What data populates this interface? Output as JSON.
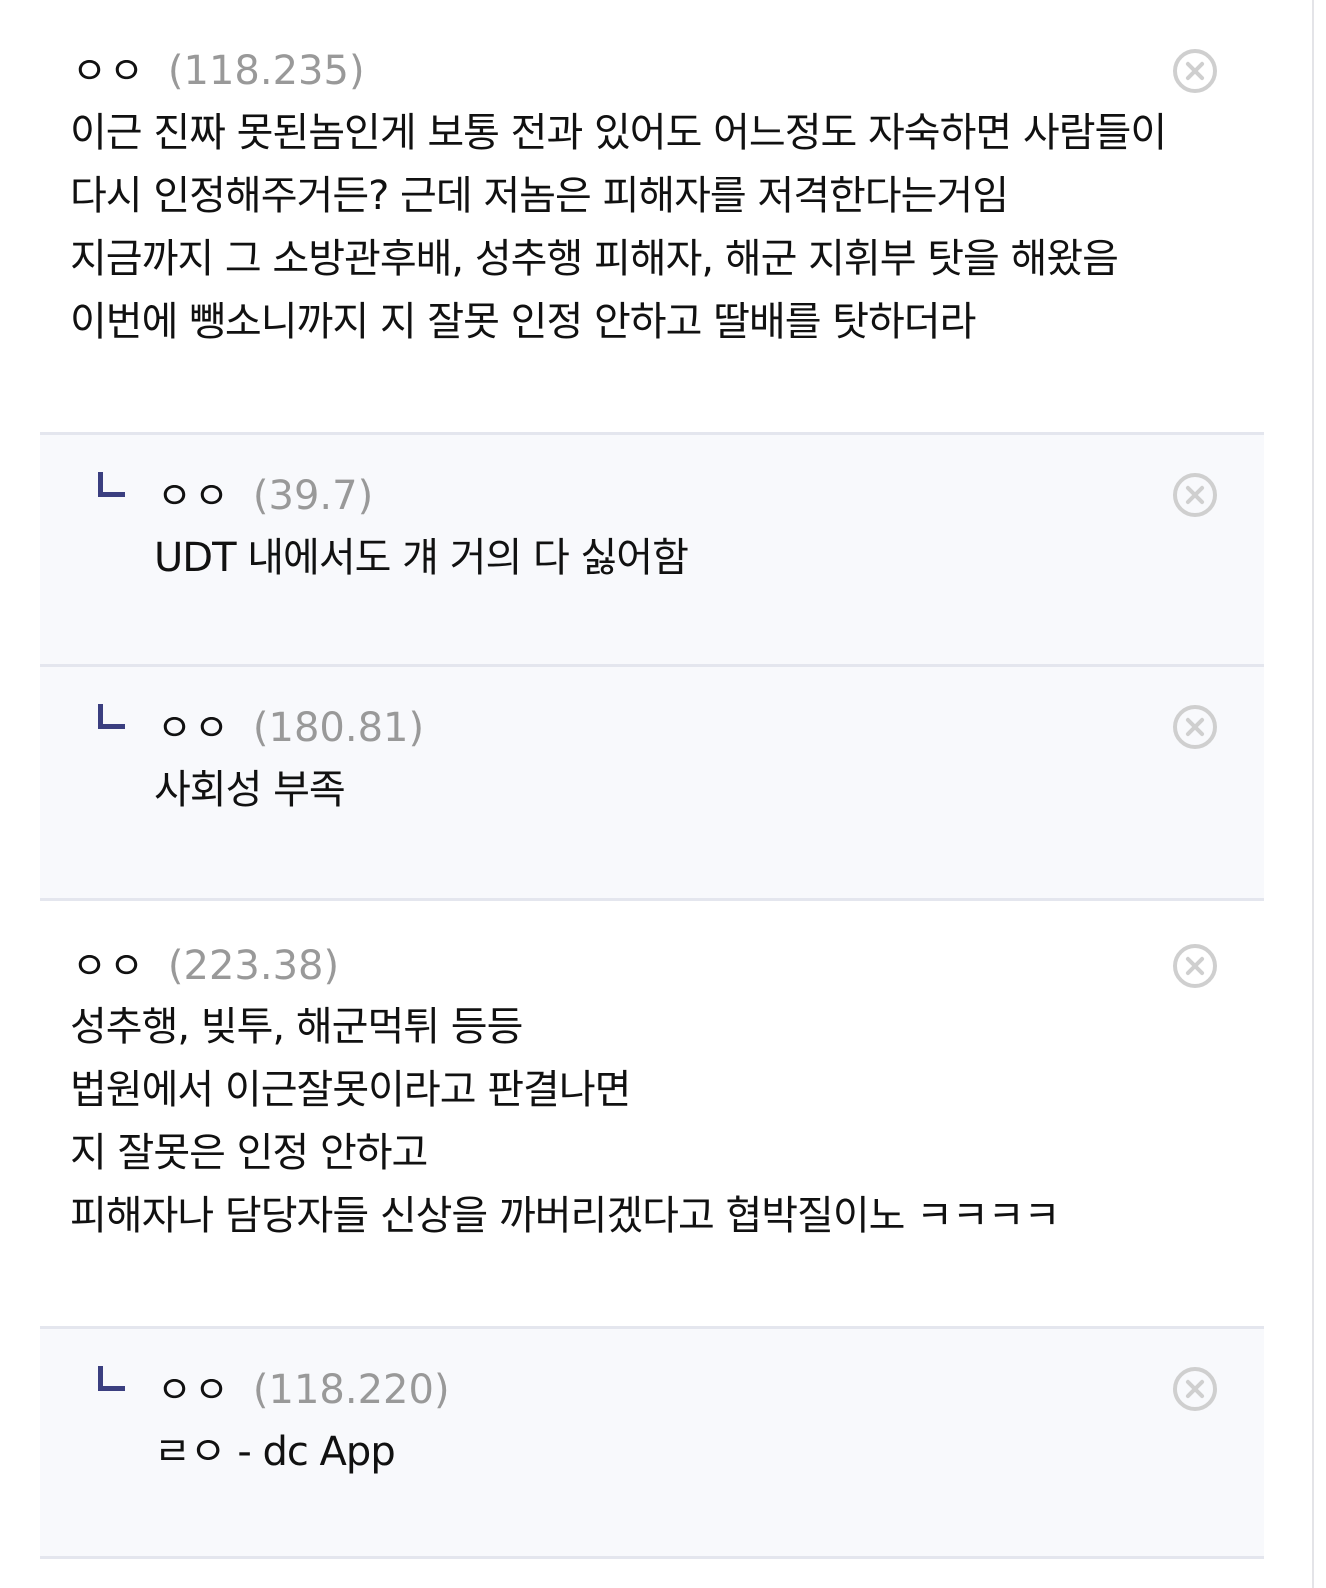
{
  "comments": [
    {
      "nick": "ㅇㅇ",
      "ip": "(118.235)",
      "lines": [
        "이근 진짜 못된놈인게 보통 전과 있어도 어느정도 자숙하면 사람들이",
        "다시 인정해주거든? 근데 저놈은 피해자를 저격한다는거임",
        "지금까지 그 소방관후배, 성추행 피해자, 해군 지휘부 탓을 해왔음",
        "이번에 뺑소니까지 지 잘못 인정 안하고 딸배를 탓하더라"
      ]
    },
    {
      "reply": true,
      "nick": "ㅇㅇ",
      "ip": "(39.7)",
      "lines": [
        "UDT 내에서도 걔 거의 다 싫어함"
      ]
    },
    {
      "reply": true,
      "nick": "ㅇㅇ",
      "ip": "(180.81)",
      "lines": [
        "사회성 부족"
      ]
    },
    {
      "nick": "ㅇㅇ",
      "ip": "(223.38)",
      "lines": [
        "성추행, 빚투, 해군먹튀 등등",
        "법원에서 이근잘못이라고 판결나면",
        "지 잘못은 인정 안하고",
        "피해자나 담당자들 신상을 까버리겠다고 협박질이노 ㅋㅋㅋㅋ"
      ]
    },
    {
      "reply": true,
      "nick": "ㅇㅇ",
      "ip": "(118.220)",
      "lines": [
        "ㄹㅇ - dc App"
      ]
    }
  ],
  "icons": {
    "delete": "close-circle-icon",
    "reply": "reply-arrow-icon"
  },
  "colors": {
    "reply_background": "#f8f9fc",
    "divider": "#e4e6ee",
    "ip_text": "#999999",
    "reply_marker": "#3b3f80",
    "delete_icon": "#cfcfcf"
  }
}
